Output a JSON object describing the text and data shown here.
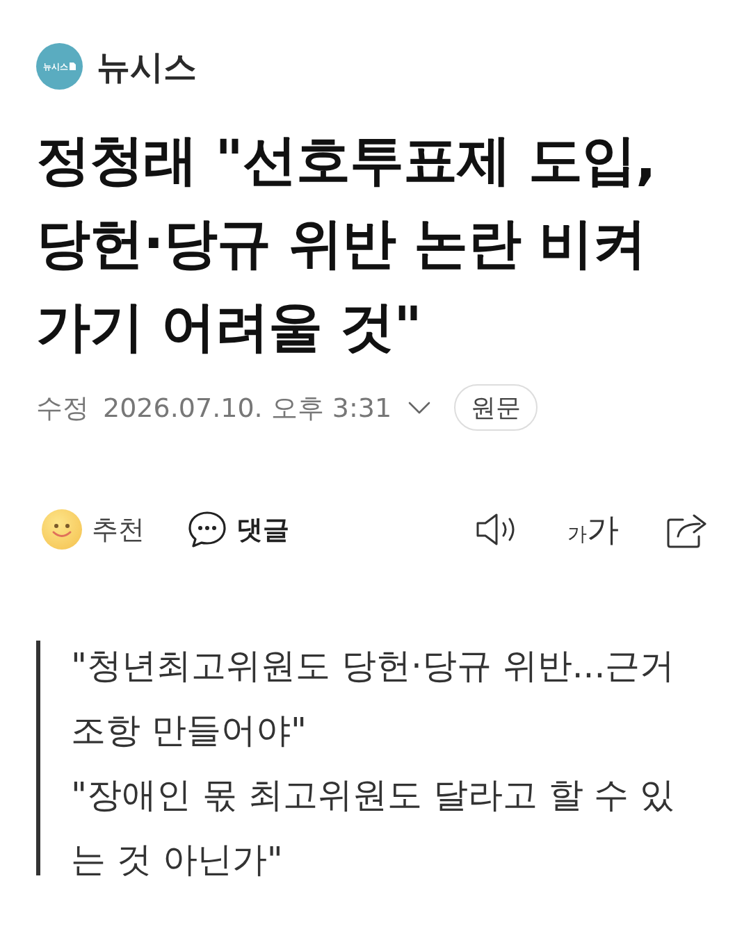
{
  "header": {
    "logo_text": "뉴시스",
    "brand": "뉴시스"
  },
  "headline": "정청래 \"선호투표제 도입, 당헌·당규 위반 논란 비켜가기 어려울 것\"",
  "meta": {
    "label": "수정",
    "datetime": "2026.07.10. 오후 3:31",
    "expanded": false,
    "original_button": "원문"
  },
  "actions": [
    {
      "kind": "recommend",
      "label": "추천"
    },
    {
      "kind": "comment",
      "label": "댓글"
    }
  ],
  "tools": [
    {
      "kind": "listen"
    },
    {
      "kind": "font_size",
      "small": "가",
      "large": "가"
    },
    {
      "kind": "share"
    }
  ],
  "summary": [
    "\"청년최고위원도 당헌·당규 위반...근거 조항 만들어야\"",
    "\"장애인 몫 최고위원도 달라고 할 수 있는 것 아닌가\""
  ]
}
